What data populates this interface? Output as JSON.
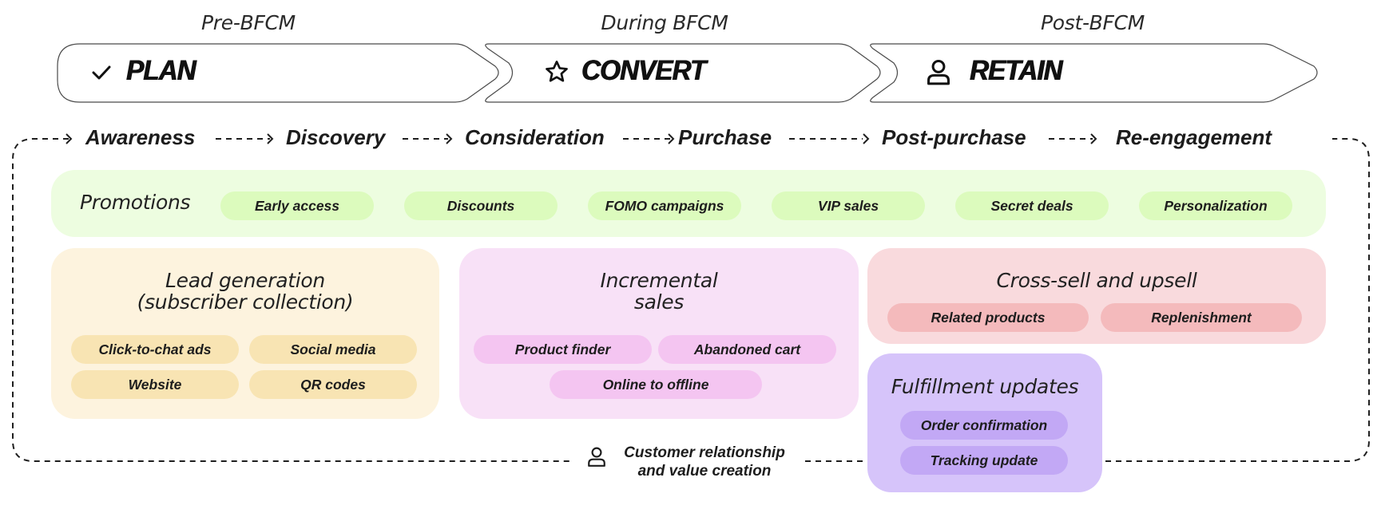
{
  "phases": [
    {
      "period": "Pre-BFCM",
      "title": "PLAN",
      "icon": "check-icon"
    },
    {
      "period": "During BFCM",
      "title": "CONVERT",
      "icon": "star-icon"
    },
    {
      "period": "Post-BFCM",
      "title": "RETAIN",
      "icon": "user-icon"
    }
  ],
  "stages": [
    "Awareness",
    "Discovery",
    "Consideration",
    "Purchase",
    "Post-purchase",
    "Re-engagement"
  ],
  "promotions": {
    "title": "Promotions",
    "items": [
      "Early access",
      "Discounts",
      "FOMO campaigns",
      "VIP sales",
      "Secret deals",
      "Personalization"
    ]
  },
  "lead_generation": {
    "title_line1": "Lead generation",
    "title_line2": "(subscriber collection)",
    "items": [
      "Click-to-chat ads",
      "Social media",
      "Website",
      "QR codes"
    ]
  },
  "incremental_sales": {
    "title_line1": "Incremental",
    "title_line2": "sales",
    "items": [
      "Product finder",
      "Abandoned cart",
      "Online to offline"
    ]
  },
  "cross_sell": {
    "title": "Cross-sell and upsell",
    "items": [
      "Related products",
      "Replenishment"
    ]
  },
  "fulfillment": {
    "title": "Fulfillment updates",
    "items": [
      "Order confirmation",
      "Tracking update"
    ]
  },
  "loop": {
    "label_line1": "Customer relationship",
    "label_line2": "and value creation",
    "icon": "user-icon"
  },
  "colors": {
    "promotions_bg": "#edfde0",
    "promotions_pill": "#dcfbbd",
    "lead_bg": "#fdf3de",
    "lead_pill": "#f8e4b3",
    "incremental_bg": "#f8e1f7",
    "incremental_pill": "#f4c5f1",
    "cross_bg": "#f9dadd",
    "cross_pill": "#f4babc",
    "fulfillment_bg": "#d6c4fa",
    "fulfillment_pill": "#c2a8f5"
  }
}
